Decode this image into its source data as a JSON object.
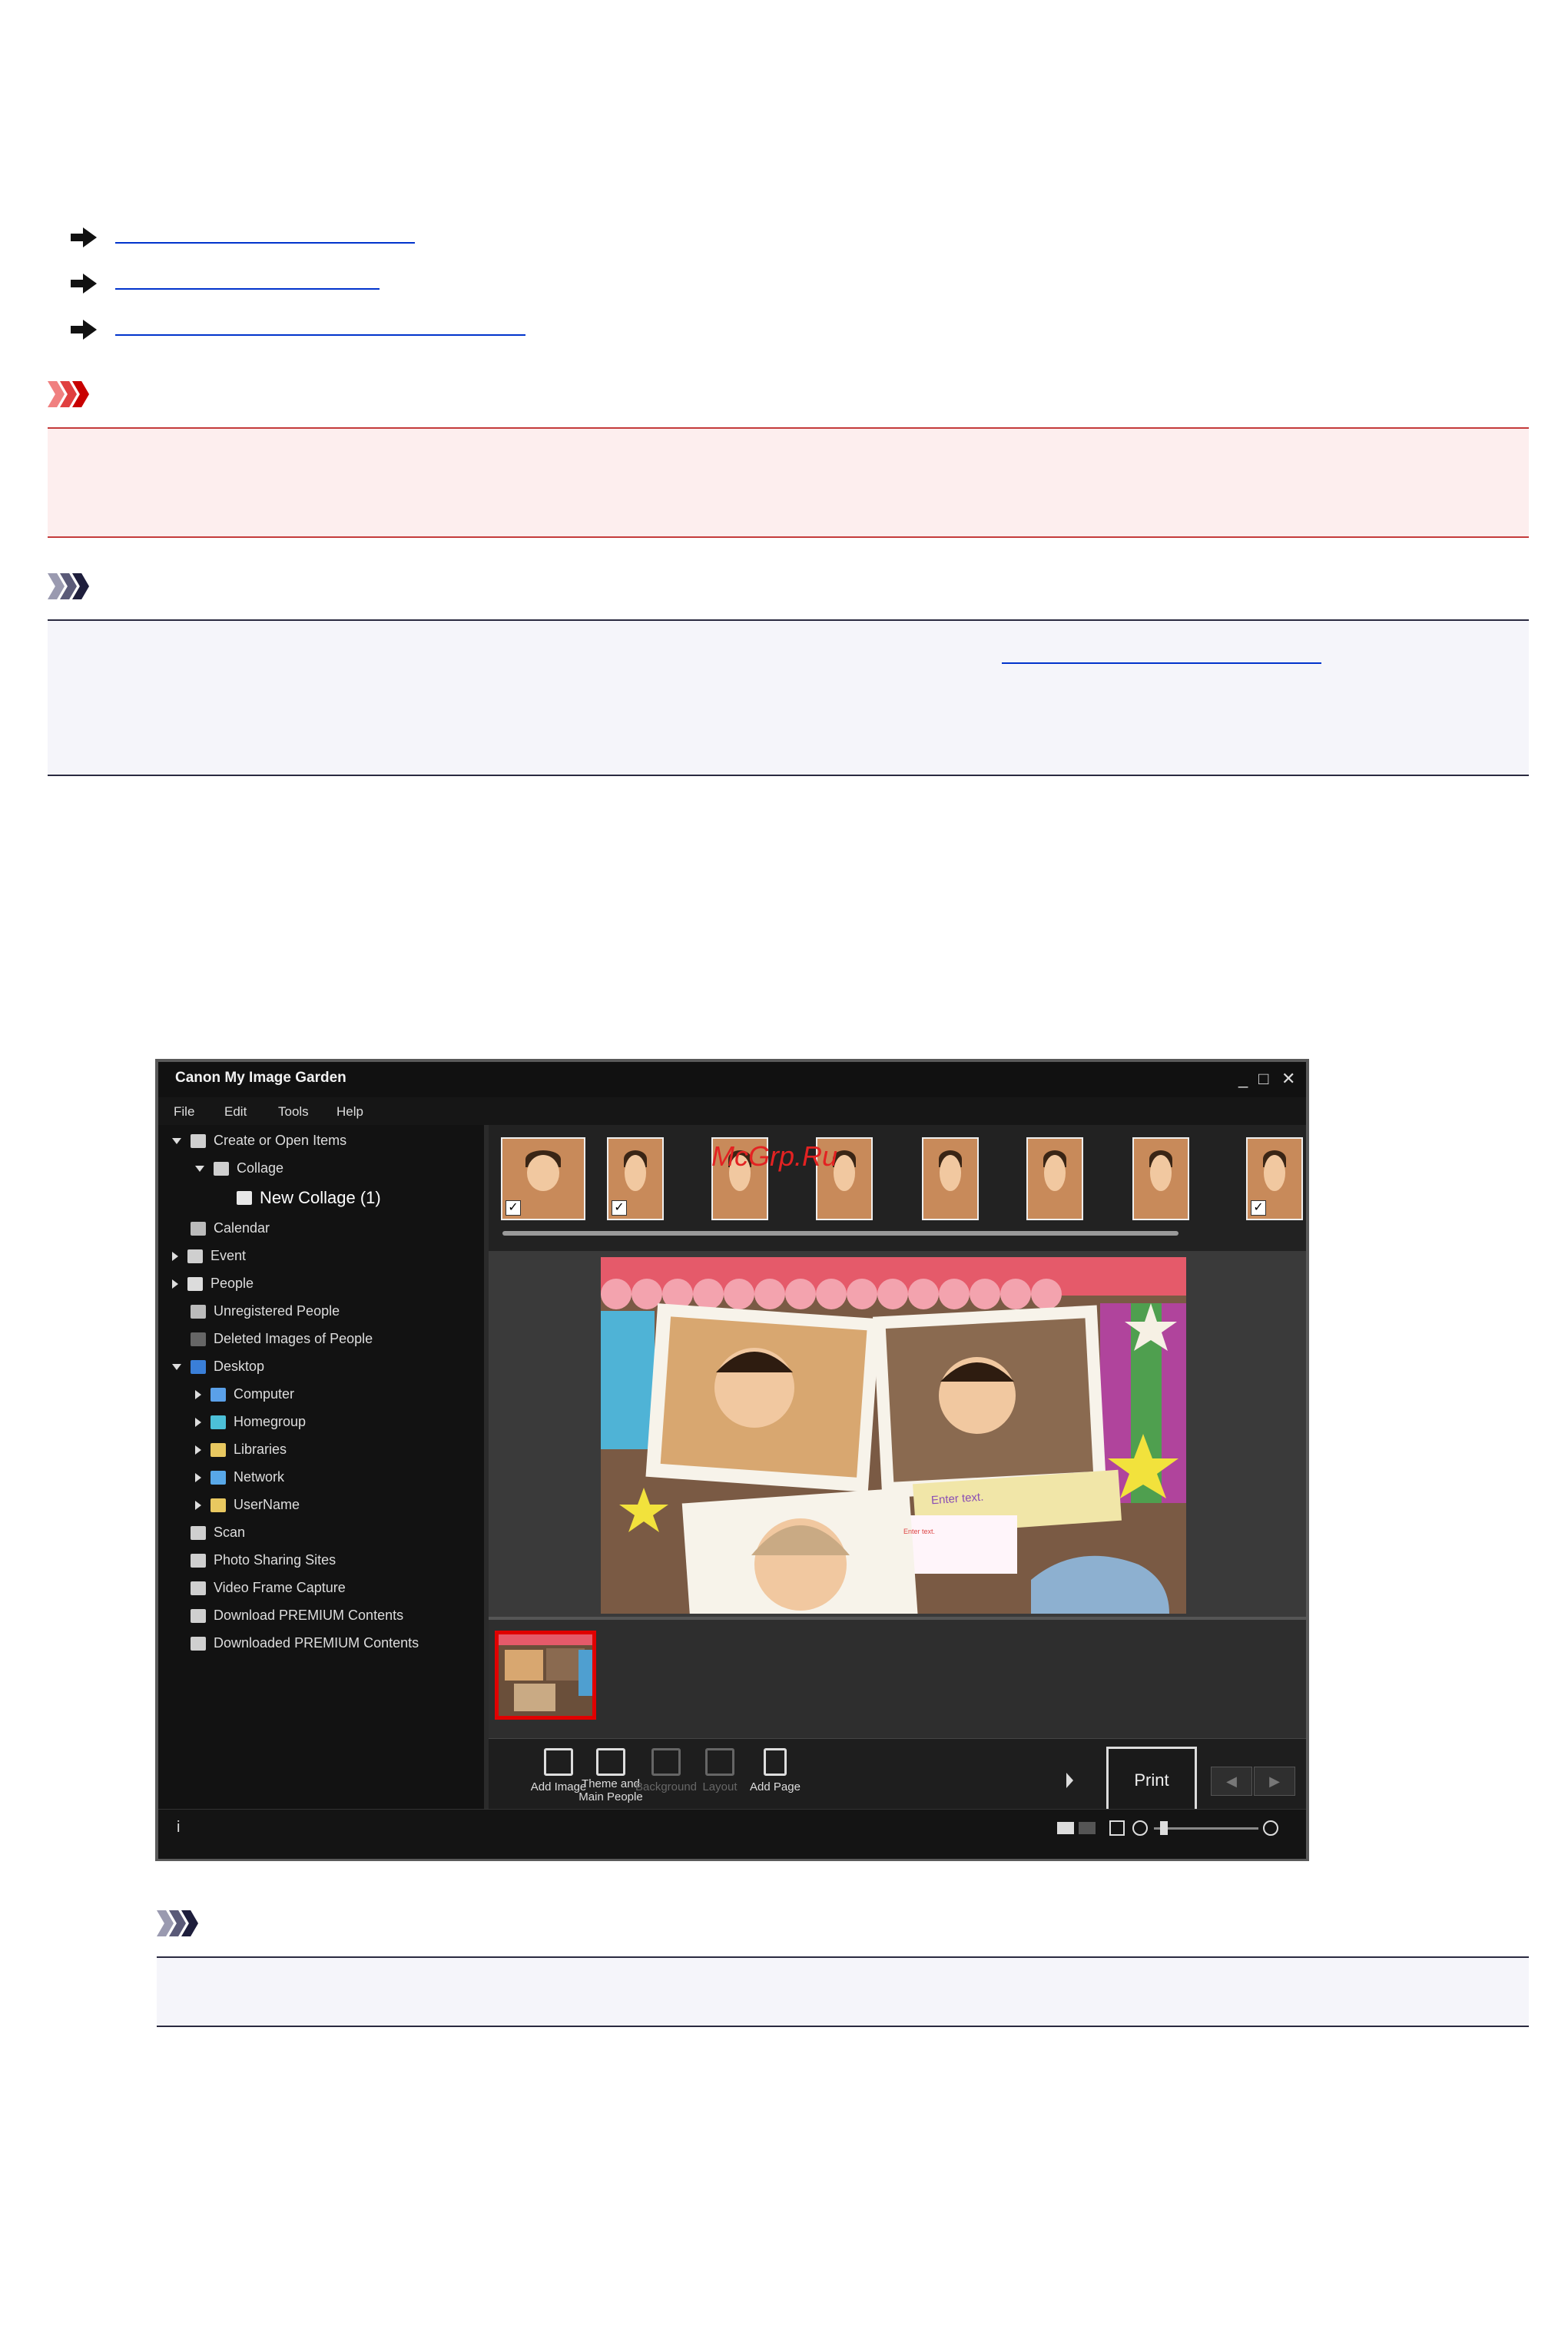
{
  "window": {
    "title": "Canon My Image Garden",
    "controls": [
      "_",
      "□",
      "✕"
    ]
  },
  "menu": [
    "File",
    "Edit",
    "Tools",
    "Help"
  ],
  "sidebar": {
    "items": [
      {
        "label": "Create or Open Items",
        "level": 0,
        "toggle": "down",
        "icon": "create-icon"
      },
      {
        "label": "Collage",
        "level": 1,
        "toggle": "down",
        "icon": "collage-icon"
      },
      {
        "label": "New Collage (1)",
        "level": 2,
        "toggle": "none",
        "icon": "collage-item-icon",
        "selected": true
      },
      {
        "label": "Calendar",
        "level": 0,
        "toggle": "none",
        "icon": "calendar-icon"
      },
      {
        "label": "Event",
        "level": 0,
        "toggle": "right",
        "icon": "event-icon"
      },
      {
        "label": "People",
        "level": 0,
        "toggle": "right",
        "icon": "people-icon"
      },
      {
        "label": "Unregistered People",
        "level": 0,
        "toggle": "none",
        "icon": "unregistered-people-icon"
      },
      {
        "label": "Deleted Images of People",
        "level": 0,
        "toggle": "none",
        "icon": "deleted-people-icon"
      },
      {
        "label": "Desktop",
        "level": 0,
        "toggle": "down",
        "icon": "desktop-icon"
      },
      {
        "label": "Computer",
        "level": 1,
        "toggle": "right",
        "icon": "computer-icon"
      },
      {
        "label": "Homegroup",
        "level": 1,
        "toggle": "right",
        "icon": "homegroup-icon"
      },
      {
        "label": "Libraries",
        "level": 1,
        "toggle": "right",
        "icon": "libraries-icon"
      },
      {
        "label": "Network",
        "level": 1,
        "toggle": "right",
        "icon": "network-icon"
      },
      {
        "label": "UserName",
        "level": 1,
        "toggle": "right",
        "icon": "user-folder-icon"
      },
      {
        "label": "Scan",
        "level": 0,
        "toggle": "none",
        "icon": "scan-icon"
      },
      {
        "label": "Photo Sharing Sites",
        "level": 0,
        "toggle": "none",
        "icon": "photo-sharing-icon"
      },
      {
        "label": "Video Frame Capture",
        "level": 0,
        "toggle": "none",
        "icon": "video-capture-icon"
      },
      {
        "label": "Download PREMIUM Contents",
        "level": 0,
        "toggle": "none",
        "icon": "download-icon"
      },
      {
        "label": "Downloaded PREMIUM Contents",
        "level": 0,
        "toggle": "none",
        "icon": "downloaded-icon"
      }
    ]
  },
  "canvas": {
    "text_placeholder_1": "Enter text.",
    "text_placeholder_2": "Enter text."
  },
  "watermark": "McGrp.Ru",
  "toolbar": {
    "add_image": "Add Image",
    "theme_line1": "Theme and",
    "theme_line2": "Main People",
    "background": "Background",
    "layout": "Layout",
    "add_page": "Add Page",
    "print": "Print"
  },
  "statusbar": {
    "info": "i"
  },
  "colors": {
    "important_border": "#c43b3b",
    "note_border": "#2a2a40",
    "link": "#0033cc",
    "selected_page": "#e00000"
  }
}
